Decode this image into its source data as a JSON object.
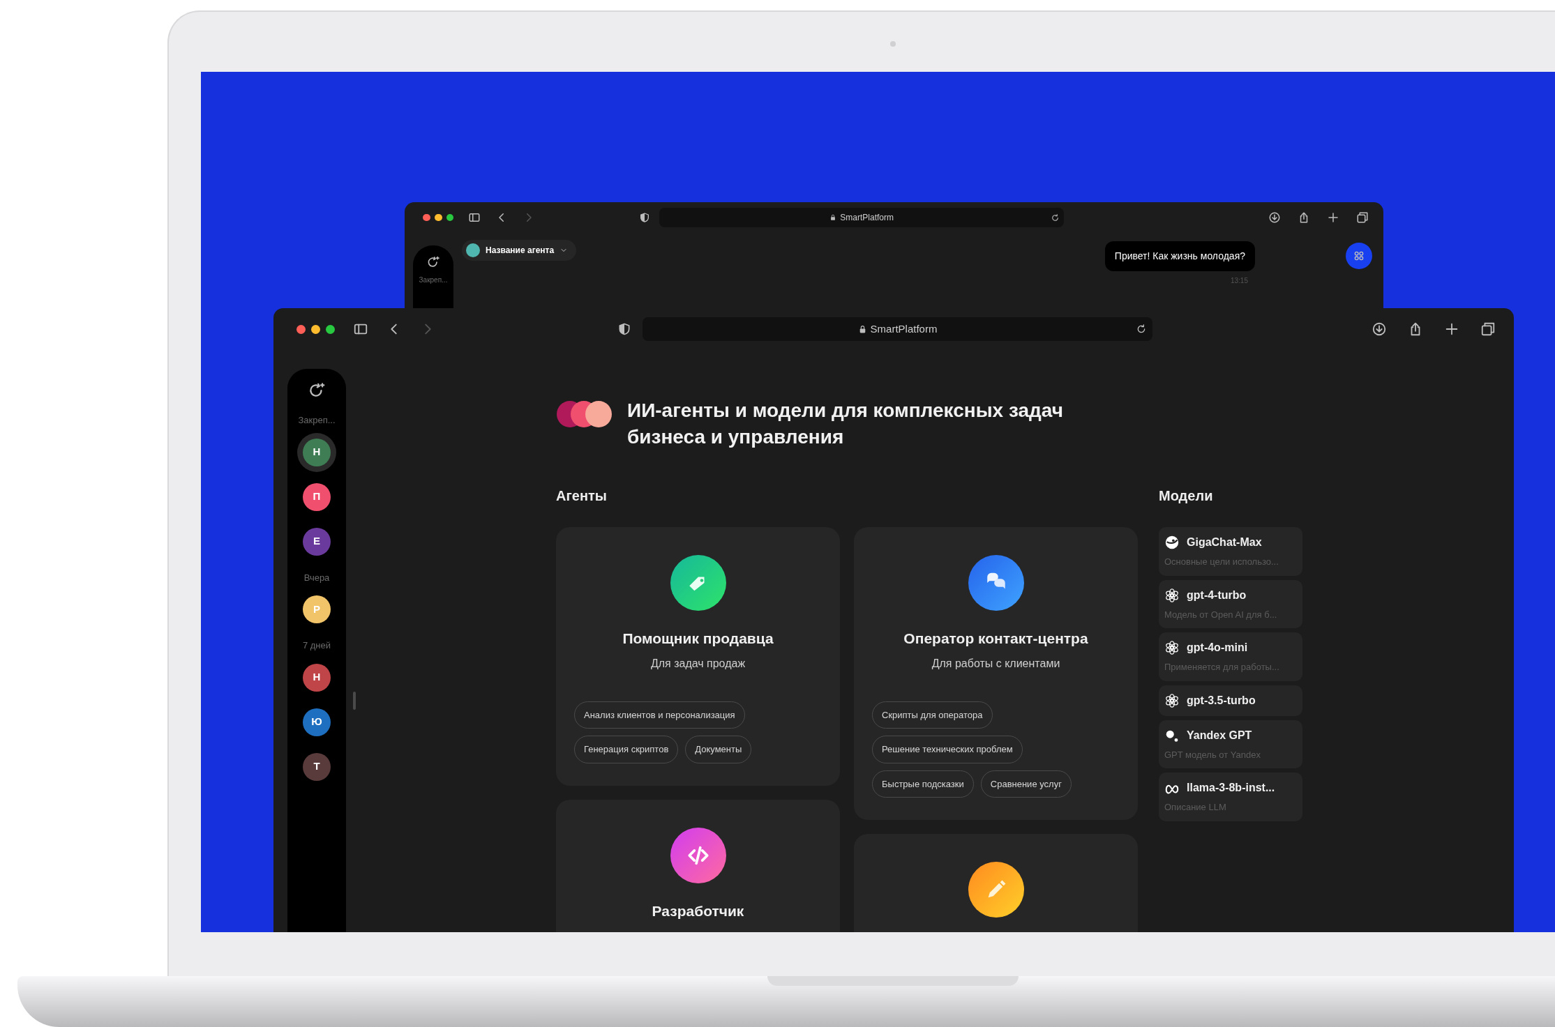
{
  "back_window": {
    "address": "SmartPlatform",
    "sidebar_label": "Закреп...",
    "agent_selector": "Название агента",
    "message": {
      "text": "Привет! Как жизнь молодая?",
      "time": "13:15"
    }
  },
  "window": {
    "address": "SmartPlatform",
    "forward_disabled": true
  },
  "sidebar": {
    "sections": [
      {
        "label": "Закреп...",
        "chats": [
          {
            "initial": "Н",
            "color": "#3f7d55",
            "selected": true
          },
          {
            "initial": "П",
            "color": "#f0506e",
            "selected": false
          },
          {
            "initial": "Е",
            "color": "#6a3a9c",
            "selected": false
          }
        ]
      },
      {
        "label": "Вчера",
        "chats": [
          {
            "initial": "Р",
            "color": "#f2c46a",
            "selected": false
          }
        ]
      },
      {
        "label": "7 дней",
        "chats": [
          {
            "initial": "Н",
            "color": "#bf4548",
            "selected": false
          },
          {
            "initial": "Ю",
            "color": "#1f6fc0",
            "selected": false
          },
          {
            "initial": "Т",
            "color": "#5a3b3b",
            "selected": false
          }
        ]
      }
    ]
  },
  "heading": "ИИ-агенты и модели для комплексных задач бизнеса и управления",
  "agents": {
    "title": "Агенты",
    "cards": [
      {
        "kind": "tag",
        "title": "Помощник продавца",
        "subtitle": "Для задач продаж",
        "tags": [
          "Анализ клиентов и персонализация",
          "Генерация скриптов",
          "Документы"
        ]
      },
      {
        "kind": "chat",
        "title": "Оператор контакт-центра",
        "subtitle": "Для работы с клиентами",
        "tags": [
          "Скрипты для оператора",
          "Решение технических проблем",
          "Быстрые подсказки",
          "Сравнение услуг"
        ]
      },
      {
        "kind": "code",
        "title": "Разработчик"
      },
      {
        "kind": "pencil"
      }
    ]
  },
  "models": {
    "title": "Модели",
    "items": [
      {
        "kind": "gigachat",
        "name": "GigaChat-Max",
        "description": "Основные цели использо..."
      },
      {
        "kind": "openai",
        "name": "gpt-4-turbo",
        "description": "Модель от Open AI для б..."
      },
      {
        "kind": "openai",
        "name": "gpt-4o-mini",
        "description": "Применяется для работы..."
      },
      {
        "kind": "openai",
        "name": "gpt-3.5-turbo"
      },
      {
        "kind": "yandex",
        "name": "Yandex GPT",
        "description": "GPT модель от Yandex"
      },
      {
        "kind": "meta",
        "name": "llama-3-8b-inst...",
        "description": "Описание LLM"
      }
    ]
  }
}
